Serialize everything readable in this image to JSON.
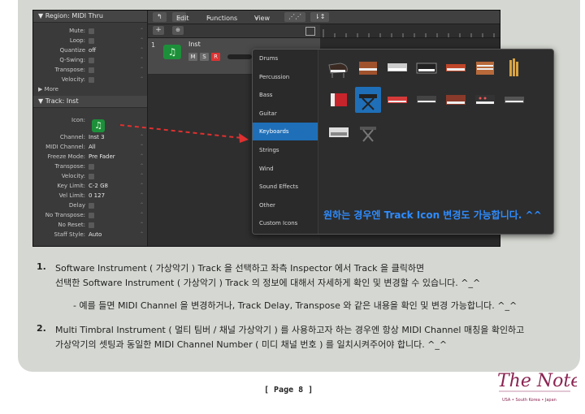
{
  "inspector": {
    "region_header": "Region: MIDI Thru",
    "region_rows": [
      {
        "label": "Mute:",
        "value": ""
      },
      {
        "label": "Loop:",
        "value": ""
      },
      {
        "label": "Quantize",
        "value": "off"
      },
      {
        "label": "Q-Swing:",
        "value": ""
      },
      {
        "label": "Transpose:",
        "value": ""
      },
      {
        "label": "Velocity:",
        "value": ""
      }
    ],
    "more": "More",
    "track_header": "Track: Inst",
    "icon_label": "Icon:",
    "track_rows": [
      {
        "label": "Channel:",
        "value": "Inst 3"
      },
      {
        "label": "MIDI Channel:",
        "value": "All"
      },
      {
        "label": "Freeze Mode:",
        "value": "Pre Fader"
      },
      {
        "label": "Transpose:",
        "value": ""
      },
      {
        "label": "Velocity:",
        "value": ""
      },
      {
        "label": "Key Limit:",
        "value": "C-2    G8"
      },
      {
        "label": "Vel Limit:",
        "value": "0    127"
      },
      {
        "label": "Delay",
        "value": ""
      },
      {
        "label": "No Transpose:",
        "value": ""
      },
      {
        "label": "No Reset:",
        "value": ""
      },
      {
        "label": "Staff Style:",
        "value": "Auto"
      }
    ]
  },
  "toolbar": {
    "edit": "Edit",
    "functions": "Functions",
    "view": "View"
  },
  "track": {
    "number": "1",
    "name": "Inst",
    "m": "M",
    "s": "S",
    "r": "R"
  },
  "popup": {
    "categories": [
      "Drums",
      "Percussion",
      "Bass",
      "Guitar",
      "Keyboards",
      "Strings",
      "Wind",
      "Sound Effects",
      "Other",
      "Custom Icons"
    ],
    "selected_category": "Keyboards",
    "overlay_text": "원하는 경우엔 Track Icon 변경도 가능합니다. ^^"
  },
  "body": {
    "item1_num": "1.",
    "item1_line1": "Software Instrument ( 가상악기 ) Track 을 선택하고 좌측 Inspector 에서 Track 을 클릭하면",
    "item1_line2": "선택한 Software Instrument ( 가상악기 ) Track 의 정보에 대해서 자세하게 확인 및 변경할 수 있습니다. ^_^",
    "item1_note": "- 예를 들면 MIDI Channel 을 변경하거나, Track Delay, Transpose 와 같은 내용을 확인 및 변경 가능합니다. ^_^",
    "item2_num": "2.",
    "item2_line1": "Multi Timbral Instrument ( 멀티 팀버 / 채널 가상악기 ) 를 사용하고자 하는 경우엔 항상 MIDI Channel 매칭을 확인하고",
    "item2_line2": "가상악기의 셋팅과 동일한 MIDI Channel Number ( 미디 채널 번호 ) 를 일치시켜주어야 합니다. ^_^"
  },
  "footer": {
    "page": "[ Page 8 ]"
  },
  "logo": {
    "name": "The Note",
    "tagline": "USA • South Korea • Japan"
  },
  "colors": {
    "panel": "#d5d8d2",
    "accent": "#1f6fb8",
    "overlay": "#2e8cff",
    "logo": "#8a2452"
  }
}
